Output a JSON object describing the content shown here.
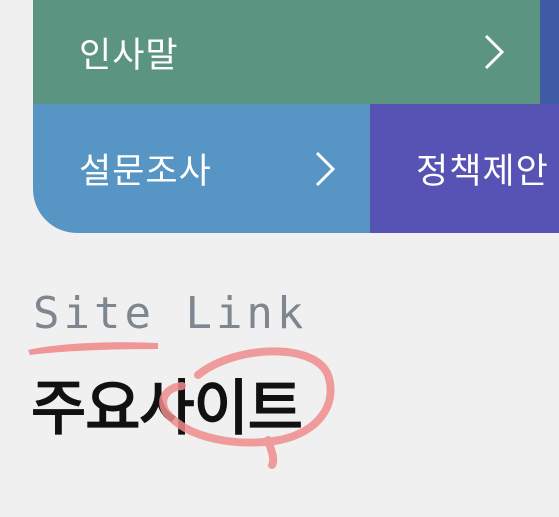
{
  "menu": {
    "greeting": {
      "label": "인사말",
      "icon": "chevron-right-icon"
    },
    "survey": {
      "label": "설문조사",
      "icon": "chevron-right-icon"
    },
    "policy": {
      "label": "정책제안"
    }
  },
  "site_links": {
    "eyebrow": "Site Link",
    "title": "주요사이트"
  },
  "colors": {
    "greeting_bg": "#5b9582",
    "survey_bg": "#5795c5",
    "policy_bg": "#5653b4",
    "edge_strip": "#3f5ba5",
    "page_bg": "#f1f0f0",
    "annotation": "#f08c8c"
  }
}
